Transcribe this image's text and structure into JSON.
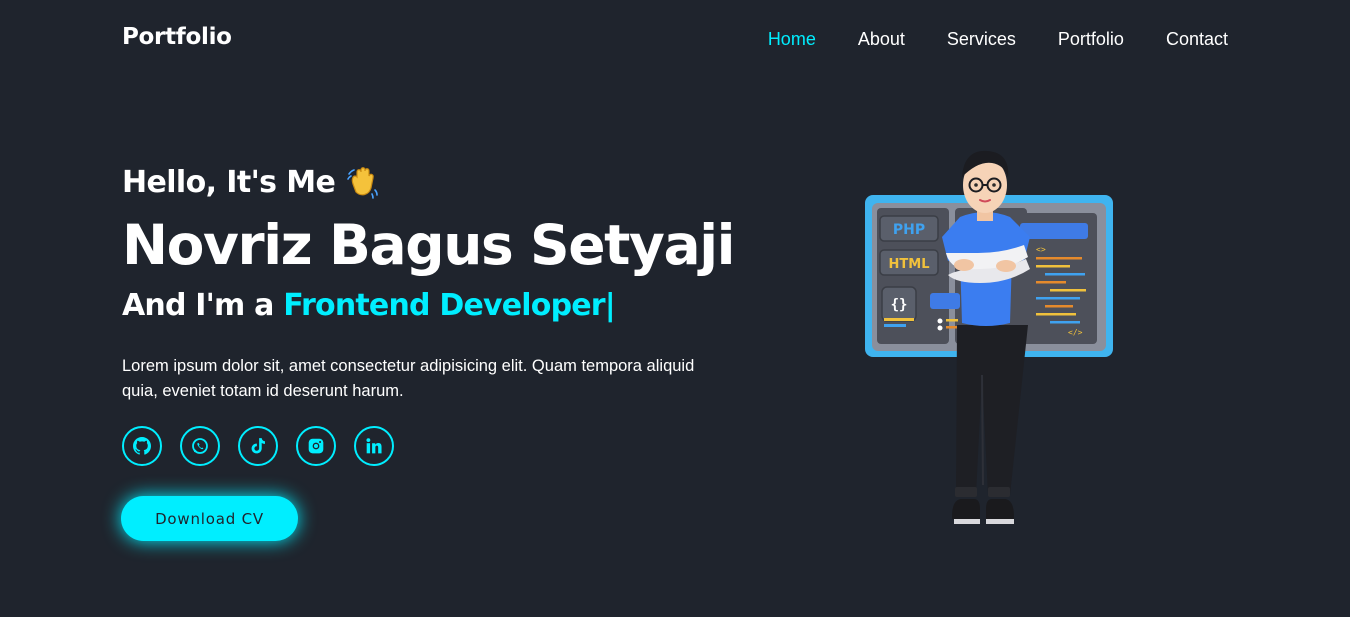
{
  "header": {
    "logo": "Portfolio",
    "nav": [
      {
        "label": "Home",
        "active": true
      },
      {
        "label": "About",
        "active": false
      },
      {
        "label": "Services",
        "active": false
      },
      {
        "label": "Portfolio",
        "active": false
      },
      {
        "label": "Contact",
        "active": false
      }
    ]
  },
  "hero": {
    "greeting": "Hello, It's Me",
    "greeting_icon": "waving-hand-icon",
    "name": "Novriz Bagus Setyaji",
    "role_prefix": "And I'm a ",
    "role": "Frontend Developer",
    "cursor": "|",
    "description": "Lorem ipsum dolor sit, amet consectetur adipisicing elit. Quam tempora aliquid quia, eveniet totam id deserunt harum.",
    "socials": [
      "github-icon",
      "whatsapp-icon",
      "tiktok-icon",
      "instagram-icon",
      "linkedin-icon"
    ],
    "cta": "Download CV"
  },
  "illustration": {
    "badges": [
      "PHP",
      "HTML",
      "{}"
    ],
    "code_tags": [
      "<>",
      "</>"
    ]
  },
  "colors": {
    "background": "#1f242d",
    "accent": "#00eeff",
    "text": "#ffffff"
  }
}
